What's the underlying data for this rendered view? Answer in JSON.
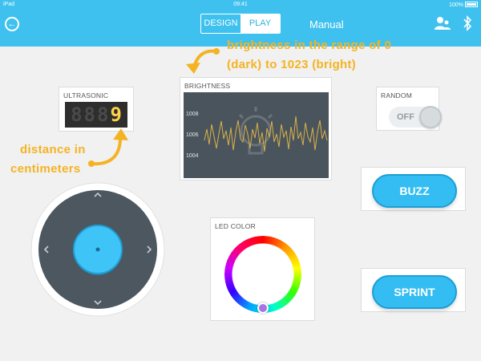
{
  "status": {
    "device": "iPad",
    "time": "09:41",
    "battery": "100%"
  },
  "header": {
    "tabs": [
      {
        "label": "DESIGN",
        "active": false
      },
      {
        "label": "PLAY",
        "active": true
      }
    ],
    "title": "Manual"
  },
  "ultrasonic": {
    "label": "ULTRASONIC",
    "digits": [
      "8",
      "8",
      "8",
      "9"
    ],
    "lit_index": 3
  },
  "brightness": {
    "label": "BRIGHTNESS",
    "ticks": [
      "1008",
      "1006",
      "1004"
    ]
  },
  "random": {
    "label": "RANDOM",
    "state": "OFF"
  },
  "led": {
    "label": "LED COLOR",
    "selected_color": "#a873e6"
  },
  "buzz": {
    "label": "BUZZ"
  },
  "sprint": {
    "label": "SPRINT"
  },
  "annotations": {
    "brightness_line1": "brightness in the range of 0",
    "brightness_line2": "(dark) to 1023 (bright)",
    "distance_line1": "distance in",
    "distance_line2": "centimeters"
  },
  "colors": {
    "accent": "#3ec1ee",
    "button": "#33bdf2",
    "annotation": "#f4b323",
    "display_lit": "#ffd24a"
  }
}
